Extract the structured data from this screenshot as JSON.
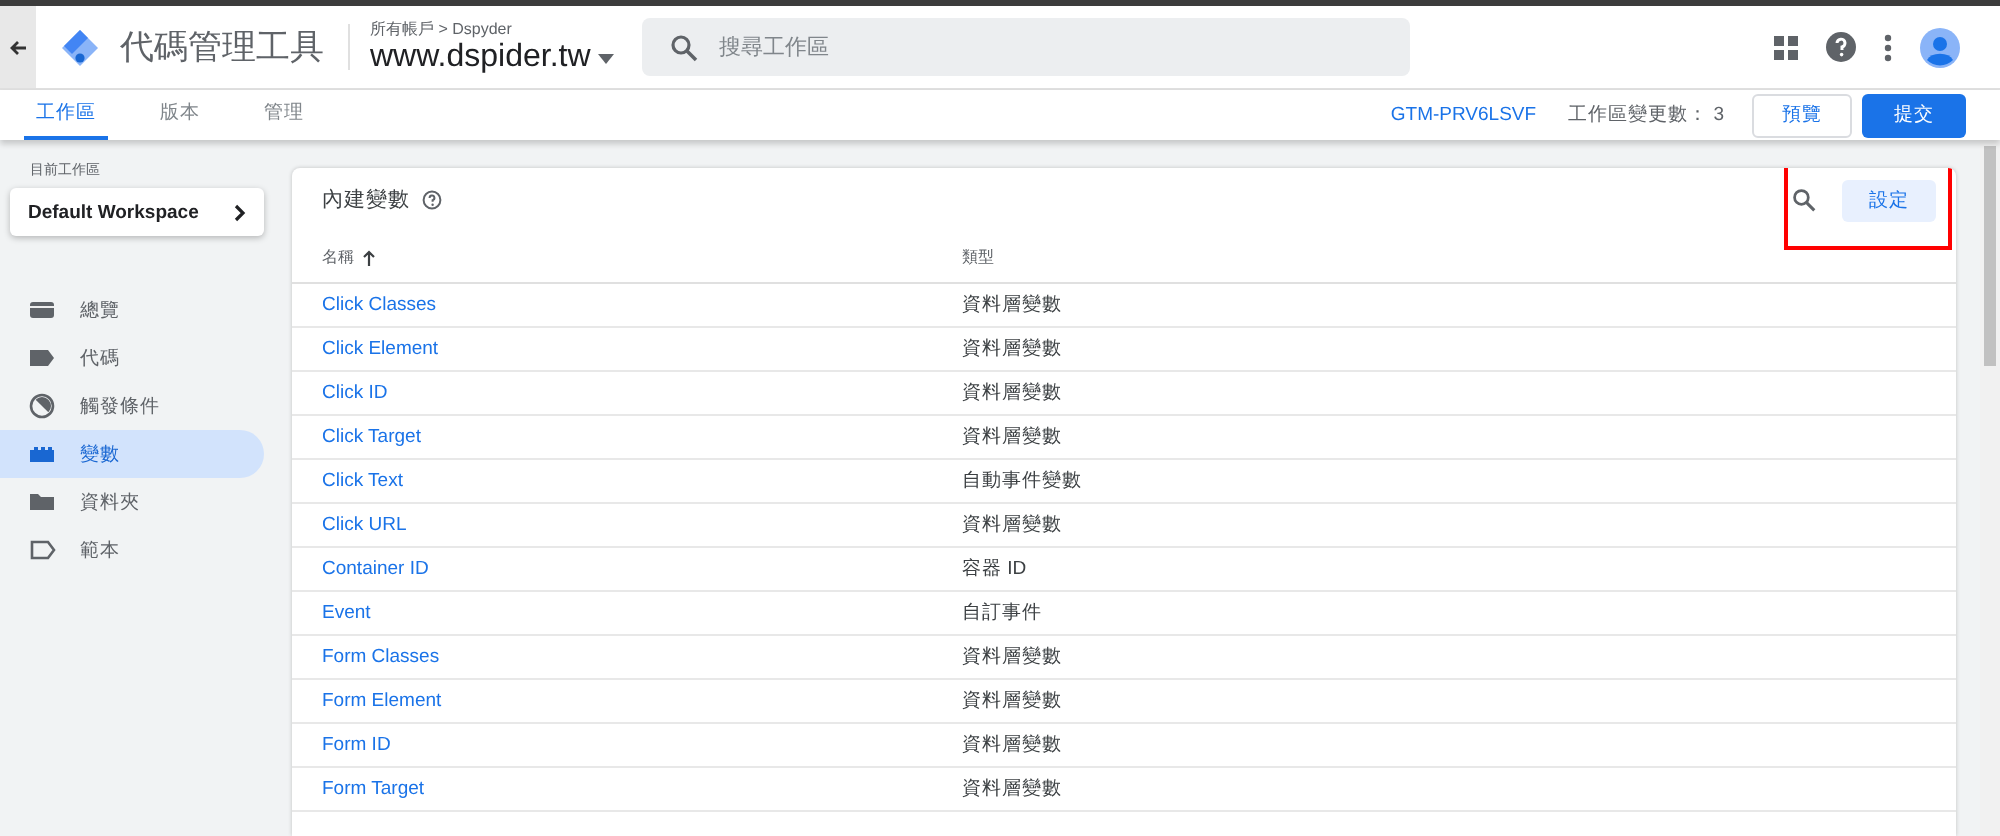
{
  "header": {
    "product": "代碼管理工具",
    "breadcrumb": "所有帳戶 > Dspyder",
    "container": "www.dspider.tw",
    "search": {
      "placeholder": "搜尋工作區"
    }
  },
  "tabs": [
    {
      "label": "工作區",
      "selected": true
    },
    {
      "label": "版本",
      "selected": false
    },
    {
      "label": "管理",
      "selected": false
    }
  ],
  "toolbar": {
    "container_id": "GTM-PRV6LSVF",
    "changes": "工作區變更數： 3",
    "buttons": [
      "預覽",
      "提交"
    ]
  },
  "sidebar": {
    "workspace_label": "目前工作區",
    "workspace": "Default Workspace",
    "items": [
      {
        "kind": "overview",
        "label": "總覽",
        "selected": false
      },
      {
        "kind": "tags",
        "label": "代碼",
        "selected": false
      },
      {
        "kind": "triggers",
        "label": "觸發條件",
        "selected": false
      },
      {
        "kind": "variables",
        "label": "變數",
        "selected": true
      },
      {
        "kind": "folders",
        "label": "資料夾",
        "selected": false
      },
      {
        "kind": "templates",
        "label": "範本",
        "selected": false
      }
    ]
  },
  "card": {
    "title": "內建變數",
    "configure_button": "設定",
    "table": {
      "columns": [
        "名稱",
        "類型"
      ],
      "rows": [
        [
          "Click Classes",
          "資料層變數"
        ],
        [
          "Click Element",
          "資料層變數"
        ],
        [
          "Click ID",
          "資料層變數"
        ],
        [
          "Click Target",
          "資料層變數"
        ],
        [
          "Click Text",
          "自動事件變數"
        ],
        [
          "Click URL",
          "資料層變數"
        ],
        [
          "Container ID",
          "容器 ID"
        ],
        [
          "Event",
          "自訂事件"
        ],
        [
          "Form Classes",
          "資料層變數"
        ],
        [
          "Form Element",
          "資料層變數"
        ],
        [
          "Form ID",
          "資料層變數"
        ],
        [
          "Form Target",
          "資料層變數"
        ]
      ]
    }
  }
}
